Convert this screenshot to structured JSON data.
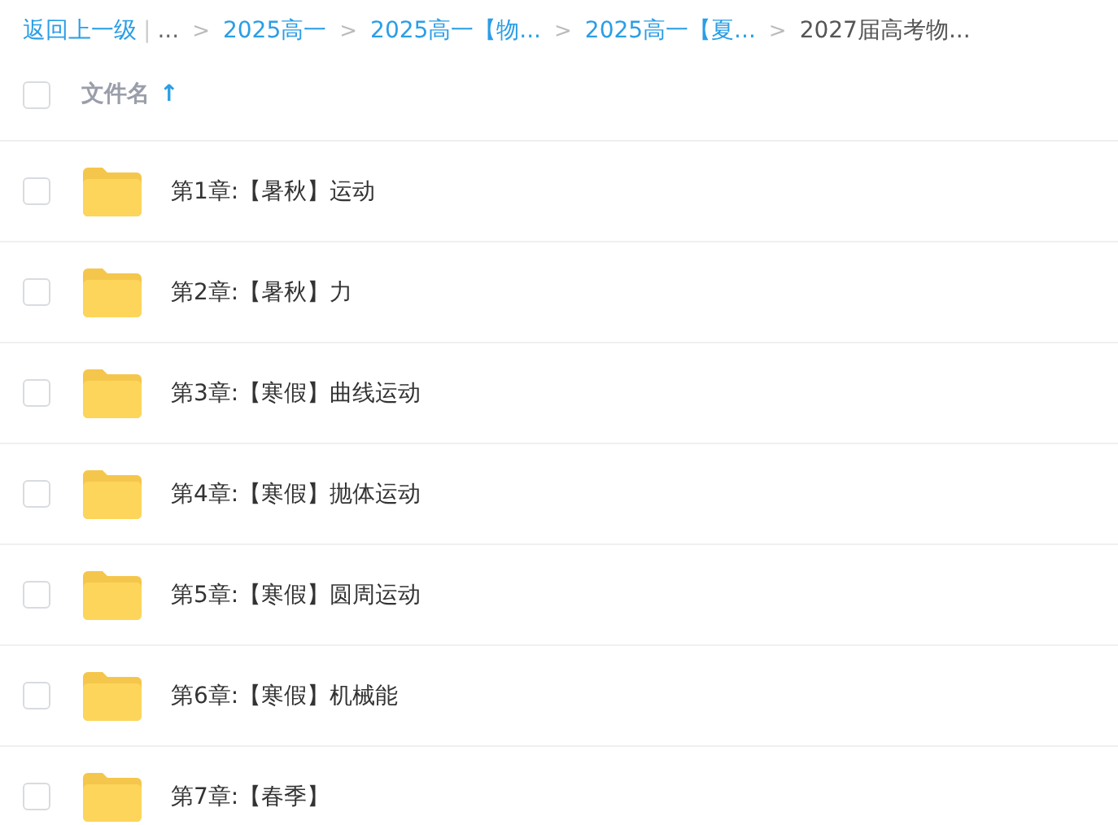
{
  "breadcrumb": {
    "back": "返回上一级",
    "divider": "|",
    "ellipsis": "...",
    "separator": ">",
    "links": [
      "2025高一",
      "2025高一【物...",
      "2025高一【夏..."
    ],
    "current": "2027届高考物..."
  },
  "header": {
    "checked": false,
    "label": "文件名",
    "sort_arrow": "↑"
  },
  "files": [
    {
      "name": "第1章:【暑秋】运动",
      "checked": false
    },
    {
      "name": "第2章:【暑秋】力",
      "checked": false
    },
    {
      "name": "第3章:【寒假】曲线运动",
      "checked": false
    },
    {
      "name": "第4章:【寒假】抛体运动",
      "checked": false
    },
    {
      "name": "第5章:【寒假】圆周运动",
      "checked": false
    },
    {
      "name": "第6章:【寒假】机械能",
      "checked": false
    },
    {
      "name": "第7章:【春季】",
      "checked": false
    }
  ]
}
